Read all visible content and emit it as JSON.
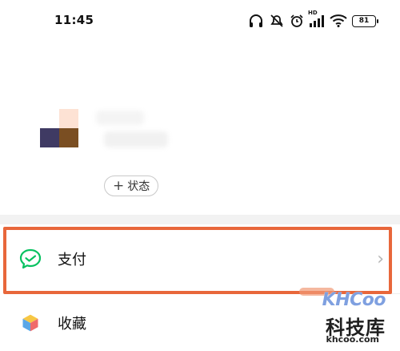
{
  "status_bar": {
    "time": "11:45",
    "network_label": "HD",
    "battery": "81",
    "icons": [
      "headphones-icon",
      "mute-icon",
      "alarm-icon",
      "signal-icon",
      "wifi-icon",
      "battery-icon"
    ]
  },
  "profile": {
    "avatar_icon": "avatar",
    "status_button": {
      "icon": "plus-icon",
      "plus": "+",
      "label": "状态"
    }
  },
  "menu": {
    "items": [
      {
        "label": "支付",
        "icon": "wechat-pay-icon",
        "chevron": "›"
      },
      {
        "label": "收藏",
        "icon": "favorites-cube-icon"
      }
    ]
  },
  "annotation": {
    "highlight_color": "#e8673b"
  },
  "watermark": {
    "logo": "KHCoo",
    "name": "科技库",
    "domain": "khcoo.com"
  },
  "colors": {
    "wechat_green": "#07c160",
    "accent_orange": "#e8673b"
  }
}
